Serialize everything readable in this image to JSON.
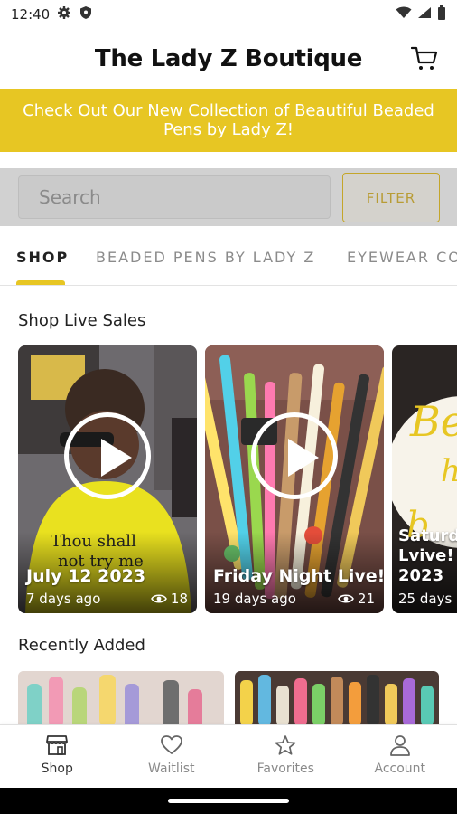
{
  "status_bar": {
    "time": "12:40",
    "icons": [
      "gear-icon",
      "shield-icon",
      "wifi-icon",
      "signal-icon",
      "battery-icon"
    ]
  },
  "header": {
    "title": "The Lady Z Boutique",
    "cart_icon": "cart-icon"
  },
  "promo": {
    "text": "Check Out Our New Collection of Beautiful Beaded Pens by Lady Z!",
    "bg_color": "#e7c623"
  },
  "search": {
    "placeholder": "Search",
    "filter_label": "FILTER"
  },
  "tabs": [
    {
      "label": "SHOP",
      "active": true
    },
    {
      "label": "BEADED PENS BY LADY Z",
      "active": false
    },
    {
      "label": "EYEWEAR CO",
      "active": false
    }
  ],
  "live_sales": {
    "title": "Shop Live Sales",
    "cards": [
      {
        "title": "July 12 2023",
        "age": "7 days ago",
        "views": "18"
      },
      {
        "title": "Friday Night Live!",
        "age": "19 days ago",
        "views": "21"
      },
      {
        "title_lines": [
          "Saturda",
          "Lvive! J",
          "2023"
        ],
        "age": "25 days"
      }
    ]
  },
  "recently_added": {
    "title": "Recently Added"
  },
  "bottom_nav": [
    {
      "label": "Shop",
      "icon": "store-icon",
      "active": true
    },
    {
      "label": "Waitlist",
      "icon": "heart-icon",
      "active": false
    },
    {
      "label": "Favorites",
      "icon": "star-icon",
      "active": false
    },
    {
      "label": "Account",
      "icon": "person-icon",
      "active": false
    }
  ],
  "colors": {
    "accent": "#e7c623",
    "filter_border": "#c4a62a"
  }
}
